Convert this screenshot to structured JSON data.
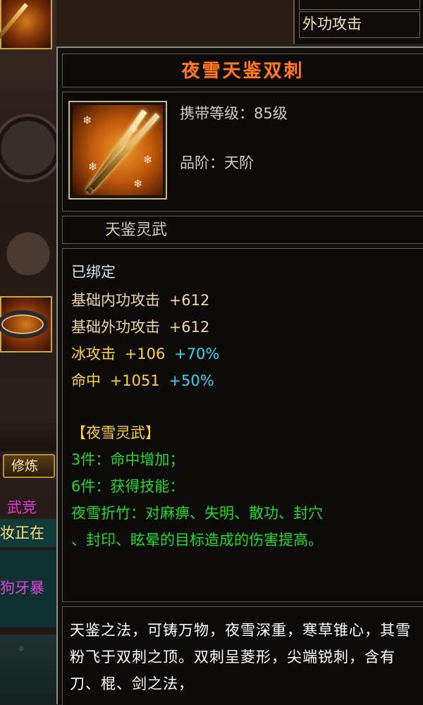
{
  "background": {
    "top_right_cells": [
      "",
      "外功攻击"
    ],
    "side_button": "修炼",
    "side_texts": [
      {
        "text": "武竞",
        "color": "#e23ad8"
      },
      {
        "text": "妆正在",
        "color": "#ffe080"
      },
      {
        "text": "狗牙暴",
        "color": "#e040e0"
      }
    ]
  },
  "item": {
    "name": "夜雪天鉴双刺",
    "carry_level": "携带等级：85级",
    "grade": "品阶：天阶",
    "set_name": "天鉴灵武",
    "colors": {
      "title": "#ff7a1e",
      "bound": "#cfe8f0",
      "base_stat": "#f0d7a8",
      "elem_stat": "#ffd23c",
      "percent": "#35d8f0",
      "set_title": "#ffd23c",
      "set_effect": "#1fdc2a"
    },
    "bound": "已绑定",
    "stats": [
      {
        "label": "基础内功攻击",
        "value": "+612",
        "percent": ""
      },
      {
        "label": "基础外功攻击",
        "value": "+612",
        "percent": ""
      },
      {
        "label": "冰攻击",
        "value": "+106",
        "percent": "+70%"
      },
      {
        "label": "命中",
        "value": "+1051",
        "percent": "+50%"
      }
    ],
    "set_title": "【夜雪灵武】",
    "set_effects": [
      "3件：命中增加；",
      "6件：获得技能：",
      "夜雪折竹：对麻痹、失明、散功、封穴",
      "、封印、眩晕的目标造成的伤害提高。"
    ],
    "description": "天鉴之法，可铸万物，夜雪深重，寒草锥心，其雪粉飞于双刺之顶。双刺呈菱形，尖端锐刺，含有刀、棍、剑之法，"
  }
}
